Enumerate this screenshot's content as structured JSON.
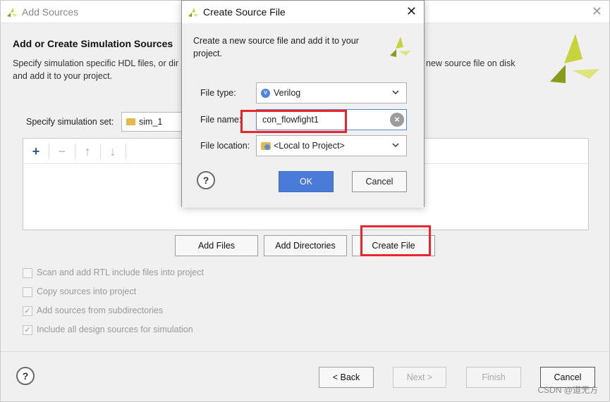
{
  "window": {
    "title": "Add Sources",
    "heading": "Add or Create Simulation Sources",
    "description_line1_left": "Specify simulation specific HDL files, or dir",
    "description_line1_right": "new source file on disk",
    "description_line2": "and add it to your project.",
    "simset_label": "Specify simulation set:",
    "simset_value": "sim_1",
    "buttons": {
      "add_files": "Add Files",
      "add_directories": "Add Directories",
      "create_file": "Create File",
      "back": "< Back",
      "next": "Next >",
      "finish": "Finish",
      "cancel": "Cancel"
    },
    "toolbar": {
      "add": "+",
      "remove": "−",
      "up": "↑",
      "down": "↓"
    },
    "options": [
      {
        "label": "Scan and add RTL include files into project",
        "checked": false
      },
      {
        "label": "Copy sources into project",
        "checked": false
      },
      {
        "label": "Add sources from subdirectories",
        "checked": true
      },
      {
        "label": "Include all design sources for simulation",
        "checked": true
      }
    ],
    "help": "?"
  },
  "dialog": {
    "title": "Create Source File",
    "message_line1": "Create a new source file and add it to your",
    "message_line2": "project.",
    "file_type_label": "File type:",
    "file_type_value": "Verilog",
    "file_name_label": "File name:",
    "file_name_value": "con_flowfight1",
    "file_location_label": "File location:",
    "file_location_value": "<Local to Project>",
    "ok": "OK",
    "cancel": "Cancel",
    "help": "?",
    "close": "✕"
  },
  "watermark": "CSDN @道无方",
  "colors": {
    "highlight": "#e8262e",
    "ok_button": "#4b7bd8",
    "logo_yellow": "#c8d43a"
  }
}
